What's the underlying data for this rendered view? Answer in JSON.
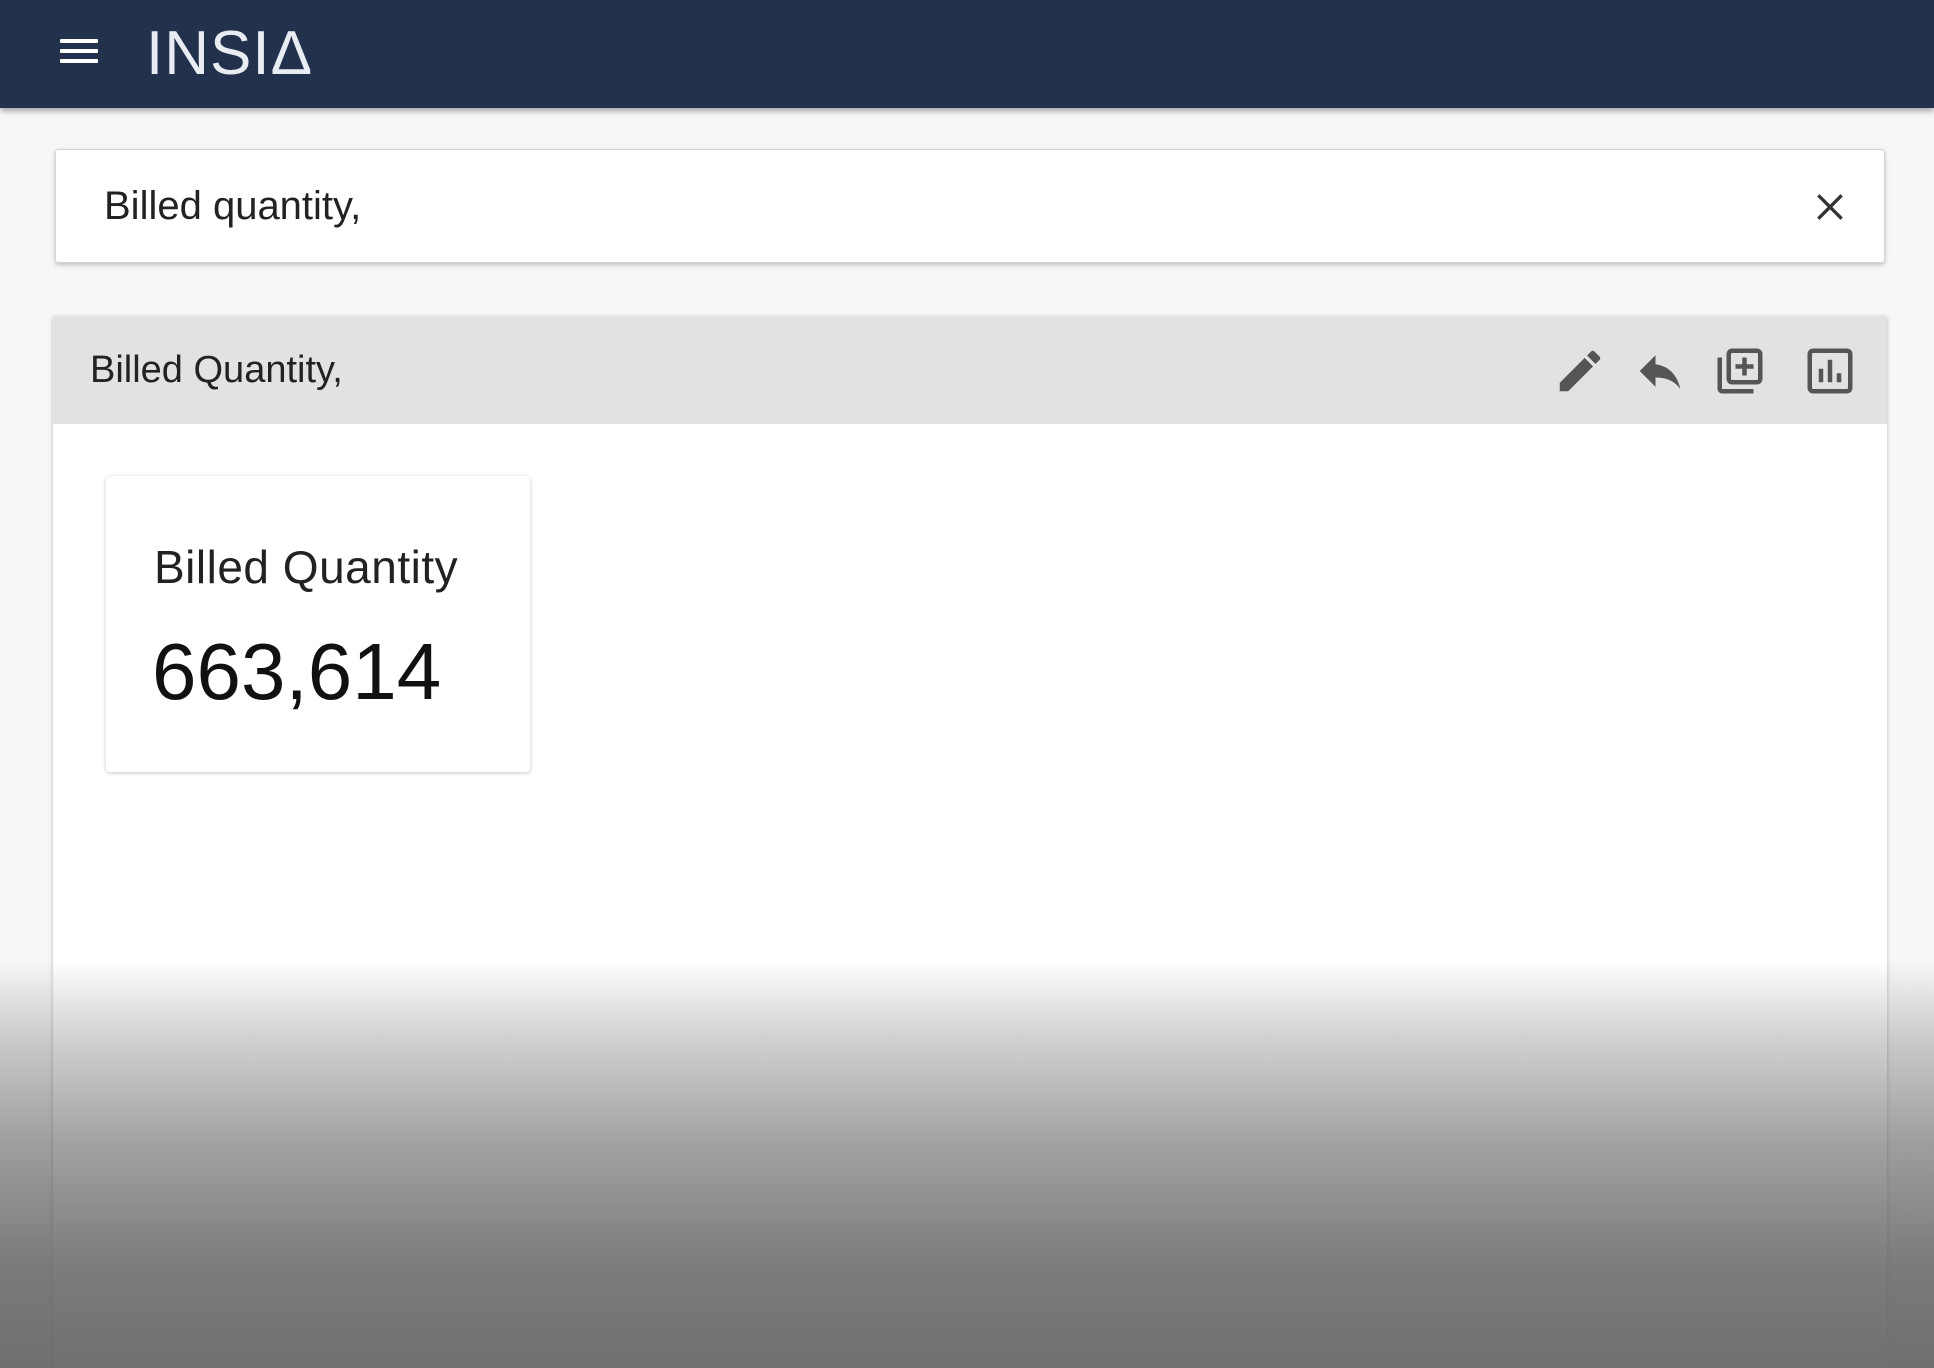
{
  "app": {
    "logo": "INSIΔ"
  },
  "icons": {
    "menu": "hamburger-menu-icon",
    "clear": "close-icon",
    "edit": "pencil-icon",
    "reply": "reply-arrow-icon",
    "add": "add-to-collection-icon",
    "chart": "bar-chart-icon"
  },
  "colors": {
    "topbar": "#22314c",
    "panel_header": "#e2e2e4",
    "icon": "#555555"
  },
  "search": {
    "value": "Billed quantity,"
  },
  "result": {
    "title": "Billed Quantity,",
    "kpi": {
      "label": "Billed Quantity",
      "value": "663,614"
    }
  }
}
